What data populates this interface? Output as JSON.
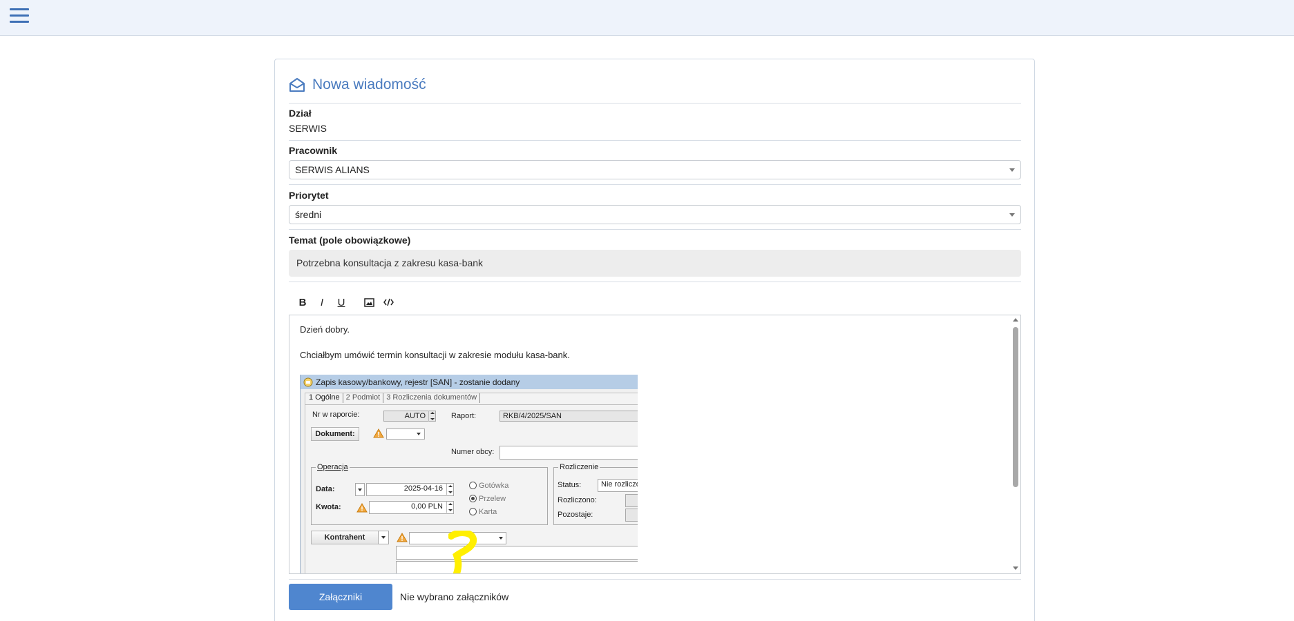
{
  "header": {
    "menu_icon": "hamburger-menu-icon",
    "accent_color": "#3d6fb5"
  },
  "form": {
    "title": "Nowa wiadomość",
    "title_icon": "envelope-open-icon",
    "department": {
      "label": "Dział",
      "value": "SERWIS"
    },
    "employee": {
      "label": "Pracownik",
      "value": "SERWIS ALIANS"
    },
    "priority": {
      "label": "Priorytet",
      "value": "średni"
    },
    "subject": {
      "label": "Temat (pole obowiązkowe)",
      "value": "Potrzebna konsultacja z zakresu kasa-bank"
    },
    "toolbar": {
      "bold": "B",
      "italic": "I",
      "underline": "U",
      "image_icon": "image-icon",
      "code_icon": "code-icon"
    },
    "editor": {
      "line1": "Dzień dobry.",
      "line2": "Chciałbym umówić termin konsultacji w zakresie modułu kasa-bank."
    },
    "attachments": {
      "button_label": "Załączniki",
      "status": "Nie wybrano załączników"
    },
    "button_color": "#4f86cf"
  },
  "embedded_screenshot": {
    "window_title": "Zapis kasowy/bankowy, rejestr [SAN] - zostanie dodany",
    "tabs": [
      "1 Ogólne",
      "2 Podmiot",
      "3 Rozliczenia dokumentów"
    ],
    "nr_w_raporcie_label": "Nr w raporcie:",
    "nr_w_raporcie_value": "AUTO",
    "raport_label": "Raport:",
    "raport_value": "RKB/4/2025/SAN",
    "dokument_button": "Dokument:",
    "numer_obcy_label": "Numer obcy:",
    "operacja_title": "Operacja",
    "data_label": "Data:",
    "data_value": "2025-04-16",
    "kwota_label": "Kwota:",
    "kwota_value": "0,00 PLN",
    "payment_options": [
      "Gotówka",
      "Przelew",
      "Karta"
    ],
    "payment_selected": "Przelew",
    "rozliczenie_title": "Rozliczenie",
    "status_label": "Status:",
    "status_value": "Nie rozliczo",
    "rozliczono_label": "Rozliczono:",
    "pozostaje_label": "Pozostaje:",
    "kontrahent_button": "Kontrahent",
    "annotation_color": "#ffef00"
  }
}
